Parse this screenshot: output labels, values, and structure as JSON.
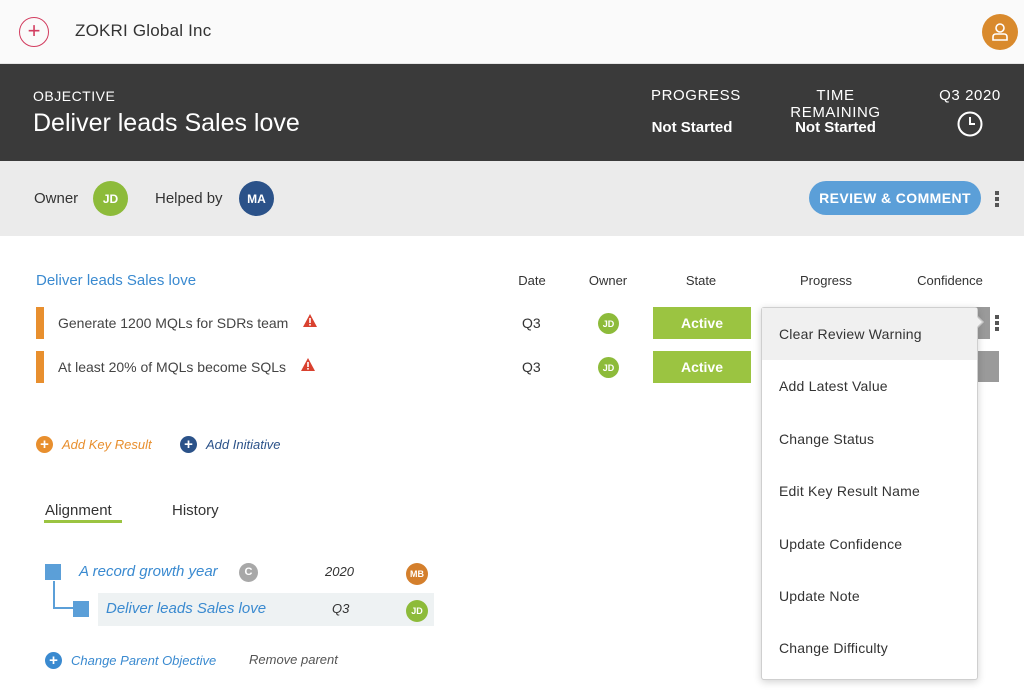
{
  "topbar": {
    "company": "ZOKRI Global Inc",
    "add_icon": "plus-circle-icon",
    "user_icon": "user-icon"
  },
  "objective": {
    "label": "OBJECTIVE",
    "title": "Deliver leads Sales love",
    "progress_label": "PROGRESS",
    "progress_value": "Not Started",
    "time_label": "TIME REMAINING",
    "time_value": "Not Started",
    "period": "Q3 2020"
  },
  "owner_bar": {
    "owner_label": "Owner",
    "owner_initials": "JD",
    "helped_label": "Helped by",
    "helper_initials": "MA",
    "review_button": "REVIEW & COMMENT"
  },
  "key_results": {
    "objective_link": "Deliver leads Sales love",
    "columns": {
      "date": "Date",
      "owner": "Owner",
      "state": "State",
      "progress": "Progress",
      "confidence": "Confidence"
    },
    "rows": [
      {
        "name": "Generate 1200 MQLs for SDRs team",
        "date": "Q3",
        "owner": "JD",
        "state": "Active"
      },
      {
        "name": "At least 20% of MQLs become SQLs",
        "date": "Q3",
        "owner": "JD",
        "state": "Active"
      }
    ],
    "add_key_result": "Add Key Result",
    "add_initiative": "Add Initiative"
  },
  "tabs": {
    "alignment": "Alignment",
    "history": "History"
  },
  "alignment": {
    "parent": {
      "name": "A record growth year",
      "badge": "C",
      "date": "2020",
      "owner": "MB"
    },
    "child": {
      "name": "Deliver leads Sales love",
      "date": "Q3",
      "owner": "JD"
    },
    "change_parent": "Change Parent Objective",
    "remove_parent": "Remove parent"
  },
  "menu": {
    "items": [
      "Clear Review Warning",
      "Add Latest Value",
      "Change Status",
      "Edit Key Result Name",
      "Update Confidence",
      "Update Note",
      "Change Difficulty"
    ]
  },
  "colors": {
    "accent_blue": "#5b9fd8",
    "header_dark": "#3a3a3a",
    "active_green": "#9bc441",
    "kr_orange": "#e88f2e",
    "brand_red": "#d23c5f"
  }
}
